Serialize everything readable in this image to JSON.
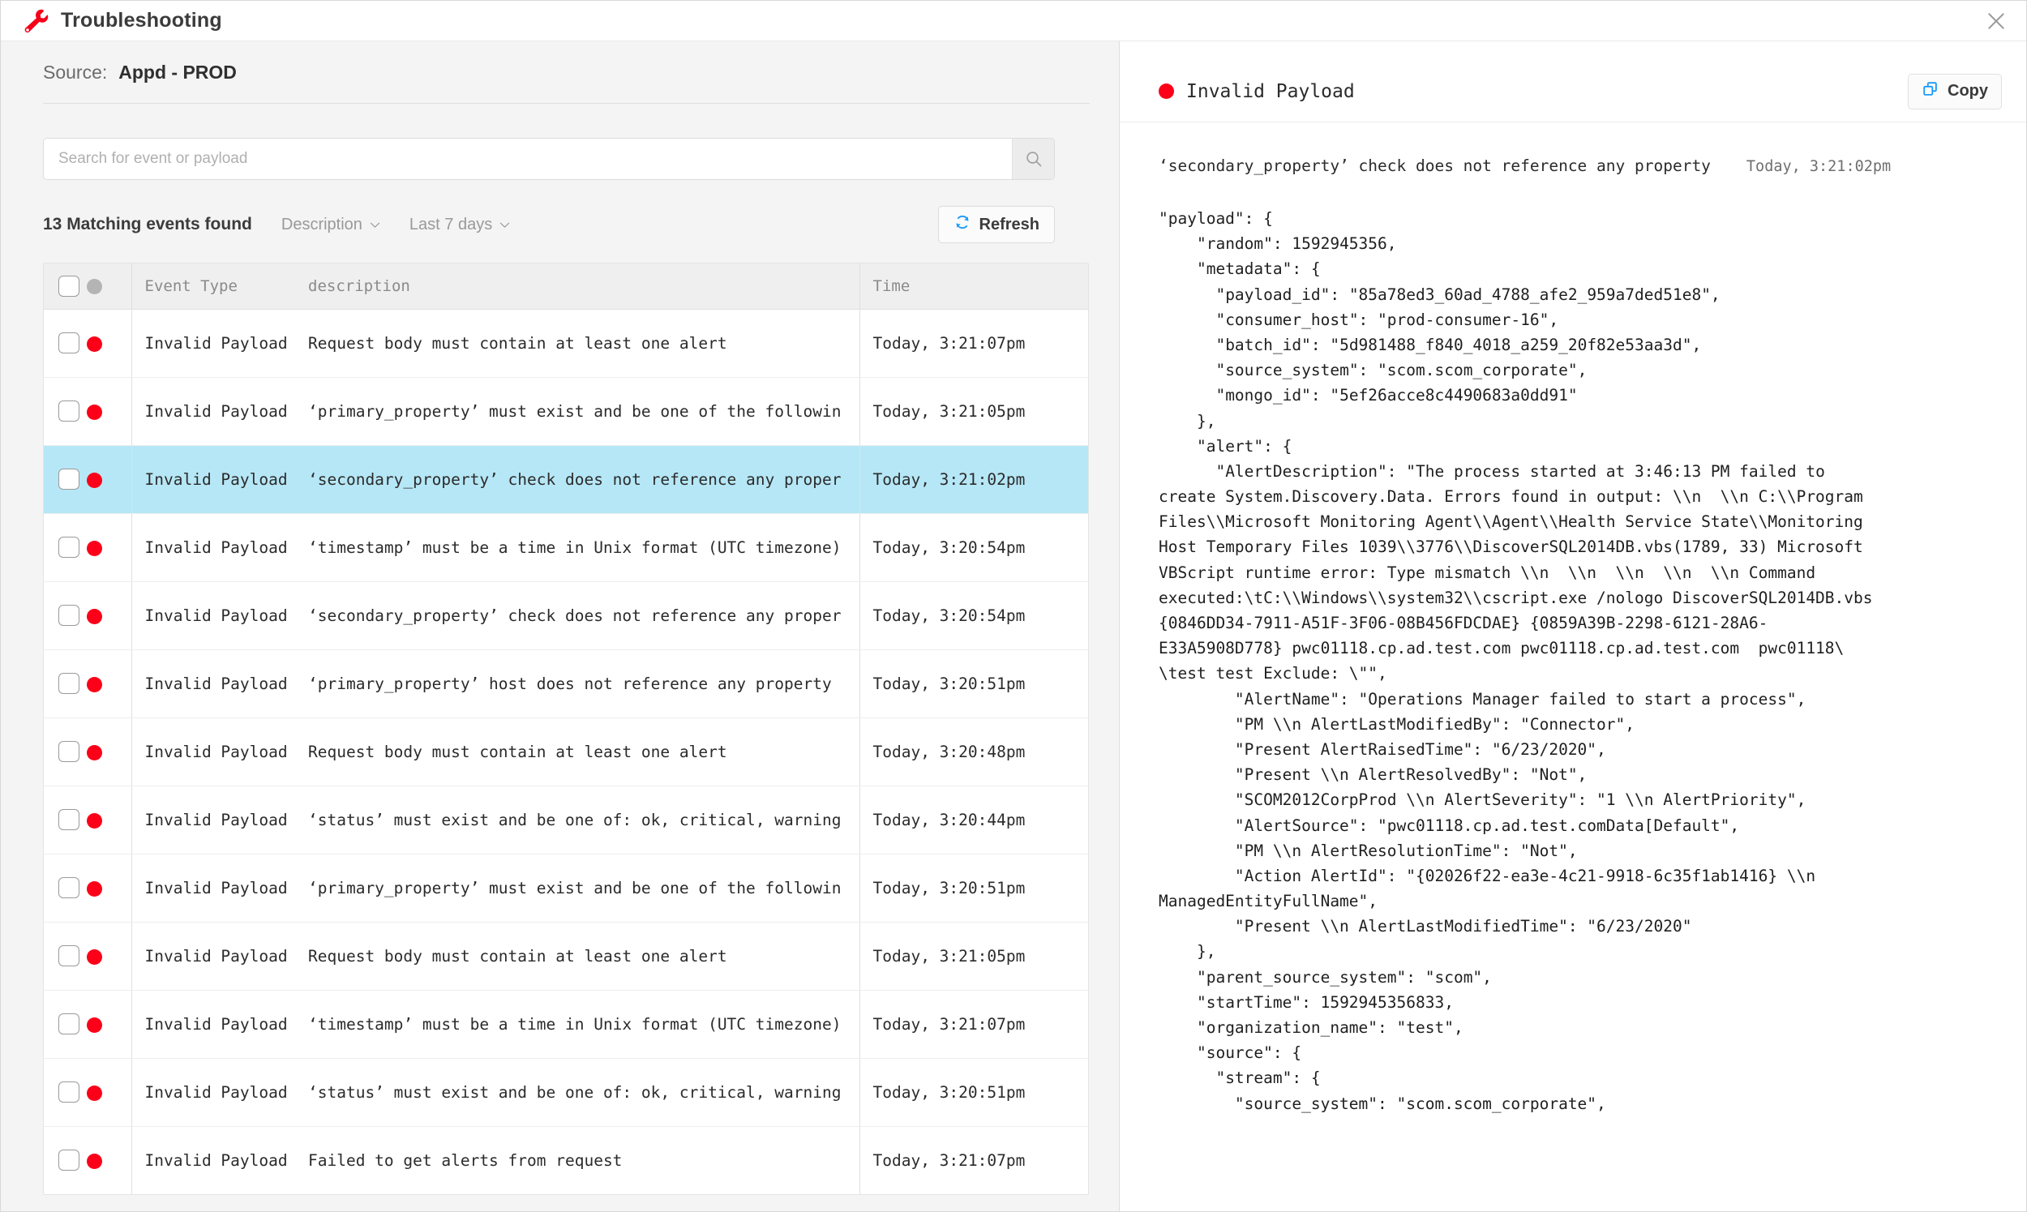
{
  "window": {
    "title": "Troubleshooting",
    "wrench_icon": "wrench-icon",
    "close_icon": "close-icon"
  },
  "source": {
    "label": "Source:",
    "value": "Appd - PROD"
  },
  "search": {
    "placeholder": "Search for event or payload",
    "value": "",
    "icon": "search-icon"
  },
  "toolbar": {
    "matching_count": "13 Matching events found",
    "filter_description": "Description",
    "filter_range": "Last 7 days",
    "refresh_label": "Refresh",
    "refresh_icon": "refresh-icon",
    "chevron": "⌄"
  },
  "table": {
    "headers": {
      "checkbox": "",
      "status": "",
      "event_type": "Event Type",
      "description": "description",
      "time": "Time"
    },
    "rows": [
      {
        "event_type": "Invalid Payload",
        "description": "Request body must contain at least one alert",
        "time": "Today, 3:21:07pm",
        "status": "error",
        "selected": false
      },
      {
        "event_type": "Invalid Payload",
        "description": "‘primary_property’ must exist and be one of the followin",
        "time": "Today, 3:21:05pm",
        "status": "error",
        "selected": false
      },
      {
        "event_type": "Invalid Payload",
        "description": "‘secondary_property’ check does not reference any proper",
        "time": "Today, 3:21:02pm",
        "status": "error",
        "selected": true
      },
      {
        "event_type": "Invalid Payload",
        "description": "‘timestamp’ must be a time in Unix format (UTC timezone)",
        "time": "Today, 3:20:54pm",
        "status": "error",
        "selected": false
      },
      {
        "event_type": "Invalid Payload",
        "description": "‘secondary_property’ check does not reference any proper",
        "time": "Today, 3:20:54pm",
        "status": "error",
        "selected": false
      },
      {
        "event_type": "Invalid Payload",
        "description": "‘primary_property’ host does not reference any property",
        "time": "Today, 3:20:51pm",
        "status": "error",
        "selected": false
      },
      {
        "event_type": "Invalid Payload",
        "description": "Request body must contain at least one alert",
        "time": "Today, 3:20:48pm",
        "status": "error",
        "selected": false
      },
      {
        "event_type": "Invalid Payload",
        "description": "‘status’ must exist and be one of: ok, critical, warning",
        "time": "Today, 3:20:44pm",
        "status": "error",
        "selected": false
      },
      {
        "event_type": "Invalid Payload",
        "description": "‘primary_property’ must exist and be one of the followin",
        "time": "Today, 3:20:51pm",
        "status": "error",
        "selected": false
      },
      {
        "event_type": "Invalid Payload",
        "description": "Request body must contain at least one alert",
        "time": "Today, 3:21:05pm",
        "status": "error",
        "selected": false
      },
      {
        "event_type": "Invalid Payload",
        "description": "‘timestamp’ must be a time in Unix format (UTC timezone)",
        "time": "Today, 3:21:07pm",
        "status": "error",
        "selected": false
      },
      {
        "event_type": "Invalid Payload",
        "description": "‘status’ must exist and be one of: ok, critical, warning",
        "time": "Today, 3:20:51pm",
        "status": "error",
        "selected": false
      },
      {
        "event_type": "Invalid Payload",
        "description": "Failed to get alerts from request",
        "time": "Today, 3:21:07pm",
        "status": "error",
        "selected": false
      }
    ]
  },
  "detail": {
    "title": "Invalid Payload",
    "status": "error",
    "copy_label": "Copy",
    "copy_icon": "copy-icon",
    "subject": "‘secondary_property’ check does not reference any property",
    "timestamp": "Today, 3:21:02pm",
    "payload_text": "\"payload\": {\n    \"random\": 1592945356,\n    \"metadata\": {\n      \"payload_id\": \"85a78ed3_60ad_4788_afe2_959a7ded51e8\",\n      \"consumer_host\": \"prod-consumer-16\",\n      \"batch_id\": \"5d981488_f840_4018_a259_20f82e53aa3d\",\n      \"source_system\": \"scom.scom_corporate\",\n      \"mongo_id\": \"5ef26acce8c4490683a0dd91\"\n    },\n    \"alert\": {\n      \"AlertDescription\": \"The process started at 3:46:13 PM failed to\ncreate System.Discovery.Data. Errors found in output: \\\\n  \\\\n C:\\\\Program\nFiles\\\\Microsoft Monitoring Agent\\\\Agent\\\\Health Service State\\\\Monitoring\nHost Temporary Files 1039\\\\3776\\\\DiscoverSQL2014DB.vbs(1789, 33) Microsoft\nVBScript runtime error: Type mismatch \\\\n  \\\\n  \\\\n  \\\\n  \\\\n Command\nexecuted:\\tC:\\\\Windows\\\\system32\\\\cscript.exe /nologo DiscoverSQL2014DB.vbs\n{0846DD34-7911-A51F-3F06-08B456FDCDAE} {0859A39B-2298-6121-28A6-\nE33A5908D778} pwc01118.cp.ad.test.com pwc01118.cp.ad.test.com  pwc01118\\\n\\test test Exclude: \\\"\",\n        \"AlertName\": \"Operations Manager failed to start a process\",\n        \"PM \\\\n AlertLastModifiedBy\": \"Connector\",\n        \"Present AlertRaisedTime\": \"6/23/2020\",\n        \"Present \\\\n AlertResolvedBy\": \"Not\",\n        \"SCOM2012CorpProd \\\\n AlertSeverity\": \"1 \\\\n AlertPriority\",\n        \"AlertSource\": \"pwc01118.cp.ad.test.comData[Default\",\n        \"PM \\\\n AlertResolutionTime\": \"Not\",\n        \"Action AlertId\": \"{02026f22-ea3e-4c21-9918-6c35f1ab1416} \\\\n\nManagedEntityFullName\",\n        \"Present \\\\n AlertLastModifiedTime\": \"6/23/2020\"\n    },\n    \"parent_source_system\": \"scom\",\n    \"startTime\": 1592945356833,\n    \"organization_name\": \"test\",\n    \"source\": {\n      \"stream\": {\n        \"source_system\": \"scom.scom_corporate\","
  },
  "colors": {
    "error_red": "#fc0019",
    "accent_blue": "#1b9af7",
    "selection_blue": "#b6e7f6",
    "panel_gray": "#f4f4f4"
  }
}
